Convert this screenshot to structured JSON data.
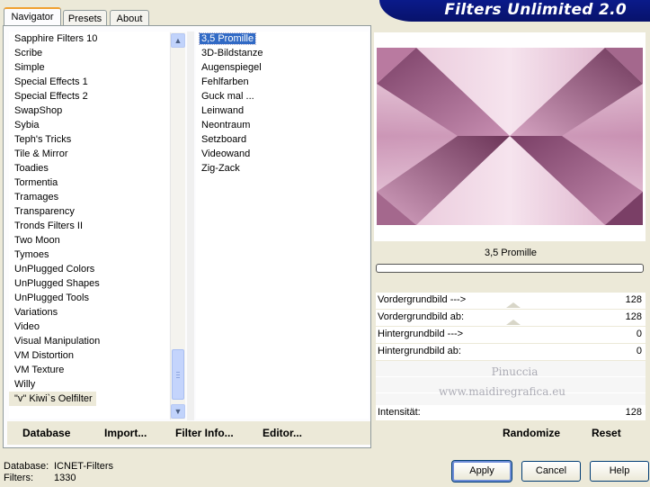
{
  "app": {
    "title": "Filters Unlimited 2.0"
  },
  "tabs": [
    {
      "label": "Navigator",
      "active": true
    },
    {
      "label": "Presets",
      "active": false
    },
    {
      "label": "About",
      "active": false
    }
  ],
  "categories": [
    "Sapphire Filters 10",
    "Scribe",
    "Simple",
    "Special Effects 1",
    "Special Effects 2",
    "SwapShop",
    "Sybia",
    "Teph's Tricks",
    "Tile & Mirror",
    "Toadies",
    "Tormentia",
    "Tramages",
    "Transparency",
    "Tronds Filters II",
    "Two Moon",
    "Tymoes",
    "UnPlugged Colors",
    "UnPlugged Shapes",
    "UnPlugged Tools",
    "Variations",
    "Video",
    "Visual Manipulation",
    "VM Distortion",
    "VM Texture",
    "Willy",
    "\"v\" Kiwi`s Oelfilter"
  ],
  "selected_category": "\"v\" Kiwi`s Oelfilter",
  "filters": [
    "3,5 Promille",
    "3D-Bildstanze",
    "Augenspiegel",
    "Fehlfarben",
    "Guck mal ...",
    "Leinwand",
    "Neontraum",
    "Setzboard",
    "Videowand",
    "Zig-Zack"
  ],
  "selected_filter": "3,5 Promille",
  "nav_buttons": {
    "database": "Database",
    "import": "Import...",
    "filter_info": "Filter Info...",
    "editor": "Editor..."
  },
  "preview": {
    "filter_name": "3,5 Promille",
    "progress": 0
  },
  "params": [
    {
      "label": "Vordergrundbild --->",
      "value": "128"
    },
    {
      "label": "Vordergrundbild ab:",
      "value": "128"
    },
    {
      "label": "Hintergrundbild --->",
      "value": "0"
    },
    {
      "label": "Hintergrundbild ab:",
      "value": "0"
    }
  ],
  "watermark": {
    "line1": "Pinuccia",
    "line2": "www.maidiregrafica.eu"
  },
  "intensity": {
    "label": "Intensität:",
    "value": "128"
  },
  "right_buttons": {
    "randomize": "Randomize",
    "reset": "Reset"
  },
  "status": {
    "database_label": "Database:",
    "database_value": "ICNET-Filters",
    "filters_label": "Filters:",
    "filters_value": "1330"
  },
  "dialog_buttons": {
    "apply": "Apply",
    "cancel": "Cancel",
    "help": "Help"
  },
  "colors": {
    "banner": "#0a1a8a",
    "selection": "#316ac5",
    "preview_pink": "#d9a6c4",
    "preview_dark": "#6e3a5e"
  }
}
